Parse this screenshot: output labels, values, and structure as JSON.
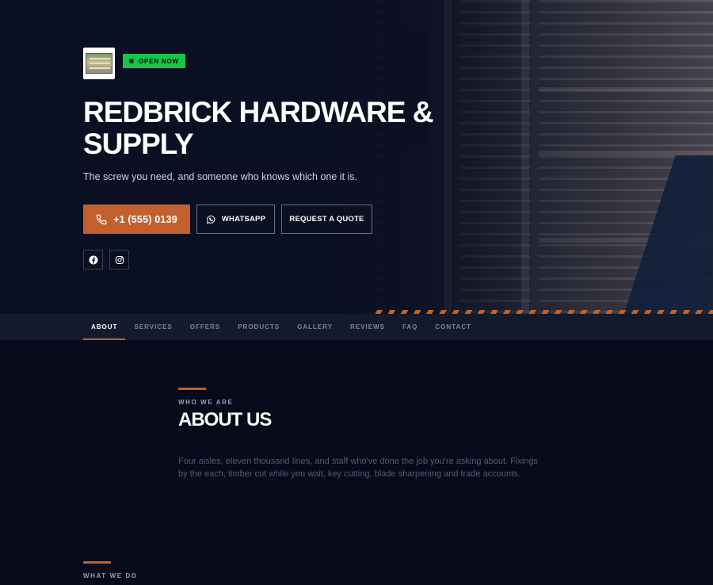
{
  "hero": {
    "status_badge": "OPEN NOW",
    "title_line1": "REDBRICK HARDWARE &",
    "title_line2": "SUPPLY",
    "tagline": "The screw you need, and someone who knows which one it is.",
    "phone_label": "+1 (555) 0139",
    "whatsapp_label": "WHATSAPP",
    "quote_label": "REQUEST A QUOTE",
    "social": [
      "facebook-icon",
      "instagram-icon"
    ]
  },
  "nav": {
    "items": [
      "ABOUT",
      "SERVICES",
      "OFFERS",
      "PRODUCTS",
      "GALLERY",
      "REVIEWS",
      "FAQ",
      "CONTACT"
    ],
    "active": "ABOUT"
  },
  "about": {
    "eyebrow": "WHO WE ARE",
    "title": "ABOUT US",
    "body": "Four aisles, eleven thousand lines, and staff who've done the job you're asking about. Fixings by the each, timber cut while you wait, key cutting, blade sharpening and trade accounts."
  },
  "services": {
    "eyebrow": "WHAT WE DO"
  },
  "colors": {
    "accent": "#c2612f",
    "open_badge": "#19c24a",
    "background": "#070a1a",
    "nav_background": "#121a2c"
  }
}
